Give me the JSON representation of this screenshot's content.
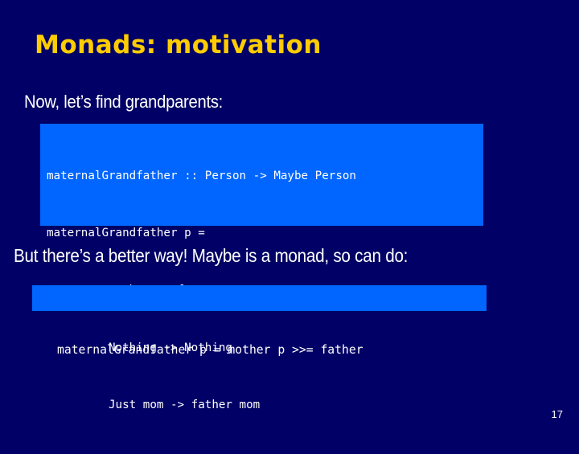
{
  "slide": {
    "title": "Monads: motivation",
    "intro_text": "Now, let’s find grandparents:",
    "code_block_1": {
      "lines": [
        "maternalGrandfather :: Person -> Maybe Person",
        "maternalGrandfather p =",
        "    case mother p of",
        "         Nothing -> Nothing",
        "         Just mom -> father mom"
      ]
    },
    "followup_text": "But there’s a better way!  Maybe is a monad, so can do:",
    "code_block_2": {
      "lines": [
        "maternalGrandfather p = mother p >>= father"
      ]
    },
    "page_number": "17"
  },
  "colors": {
    "background": "#000066",
    "title": "#FFCC00",
    "code_background": "#0066FF",
    "text": "#FFFFFF"
  }
}
